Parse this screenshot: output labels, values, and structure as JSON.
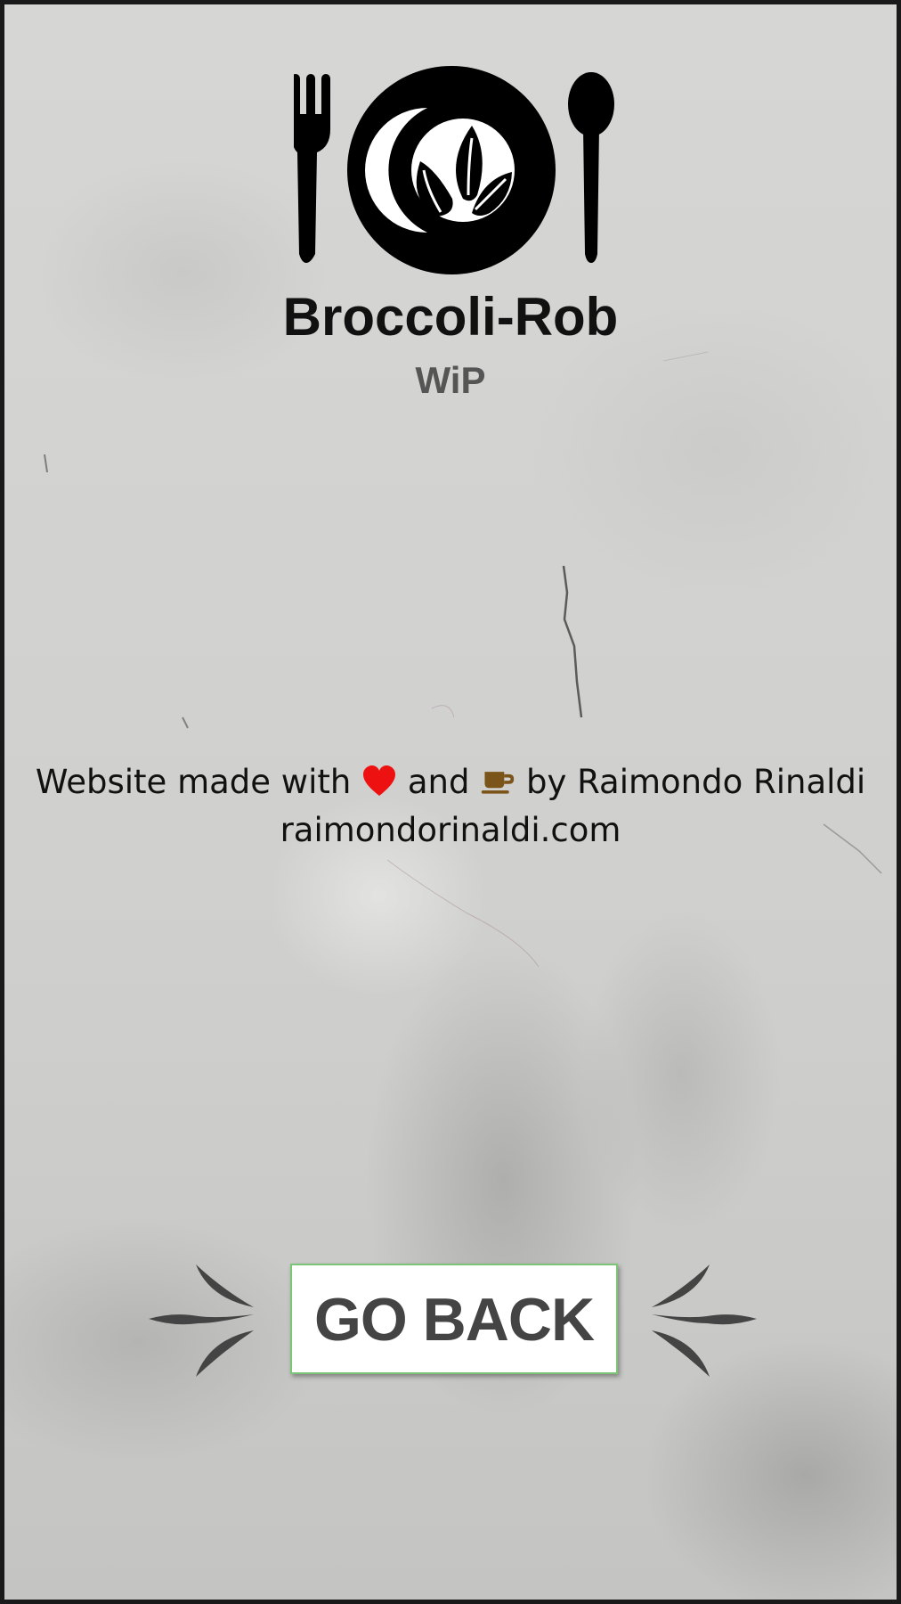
{
  "brand": {
    "title": "Broccoli-Rob",
    "subtitle": "WiP",
    "logo_icon": "plate-fork-spoon-leaf-icon"
  },
  "credit": {
    "prefix": "Website made with",
    "heart_icon": "heart-icon",
    "and_text": "and",
    "coffee_icon": "coffee-cup-icon",
    "suffix": "by Raimondo Rinaldi",
    "link_text": "raimondorinaldi.com"
  },
  "actions": {
    "go_back_label": "GO BACK",
    "flourish_icon": "flourish-icon"
  },
  "colors": {
    "heart": "#ee1111",
    "coffee": "#7a5418",
    "button_border": "#7cc576",
    "button_text": "#444444"
  }
}
